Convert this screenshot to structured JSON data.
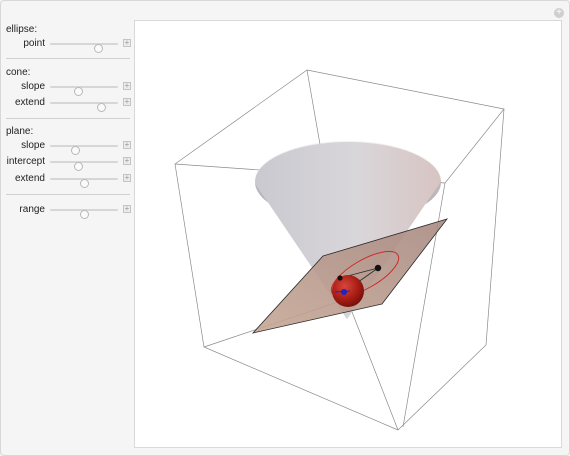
{
  "controls": {
    "ellipse": {
      "title": "ellipse:",
      "sliders": [
        {
          "label": "point",
          "value": 0.72
        }
      ]
    },
    "cone": {
      "title": "cone:",
      "sliders": [
        {
          "label": "slope",
          "value": 0.42
        },
        {
          "label": "extend",
          "value": 0.75
        }
      ]
    },
    "plane": {
      "title": "plane:",
      "sliders": [
        {
          "label": "slope",
          "value": 0.38
        },
        {
          "label": "intercept",
          "value": 0.42
        },
        {
          "label": "extend",
          "value": 0.5
        }
      ]
    },
    "range": {
      "sliders": [
        {
          "label": "range",
          "value": 0.5
        }
      ]
    }
  },
  "colors": {
    "cone": "#c8c8cc",
    "plane": "#b8978a",
    "sphere": "#b01c14",
    "ellipse": "#cc2a2a",
    "focus": "#1a24c8"
  }
}
